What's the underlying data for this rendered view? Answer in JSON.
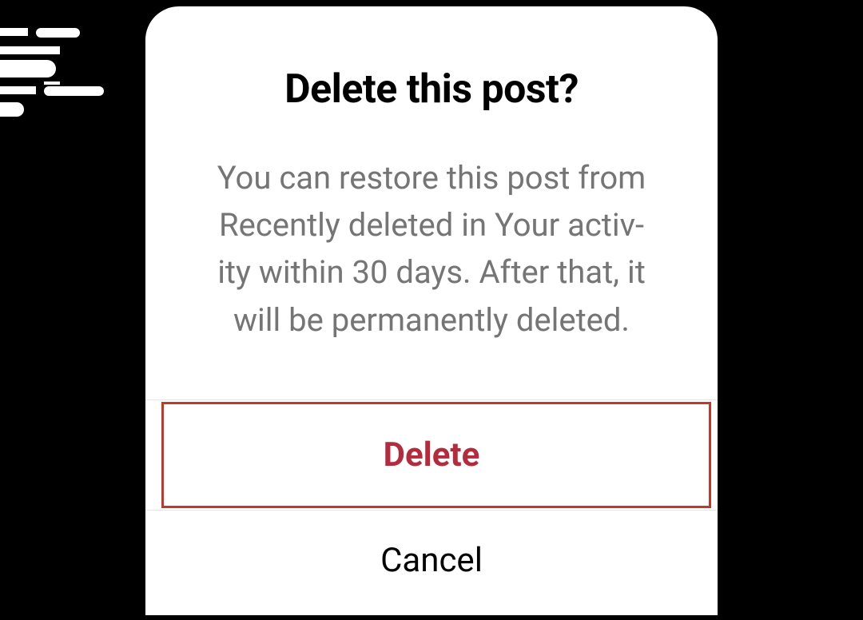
{
  "dialog": {
    "title": "Delete this post?",
    "body": "You can restore this post from Recently deleted in Your activ­ity within 30 days. After that, it will be permanently deleted.",
    "actions": {
      "delete_label": "Delete",
      "cancel_label": "Cancel"
    },
    "colors": {
      "destructive": "#b52b3e",
      "body_text": "#757575",
      "highlight_border": "#c0392b"
    }
  }
}
